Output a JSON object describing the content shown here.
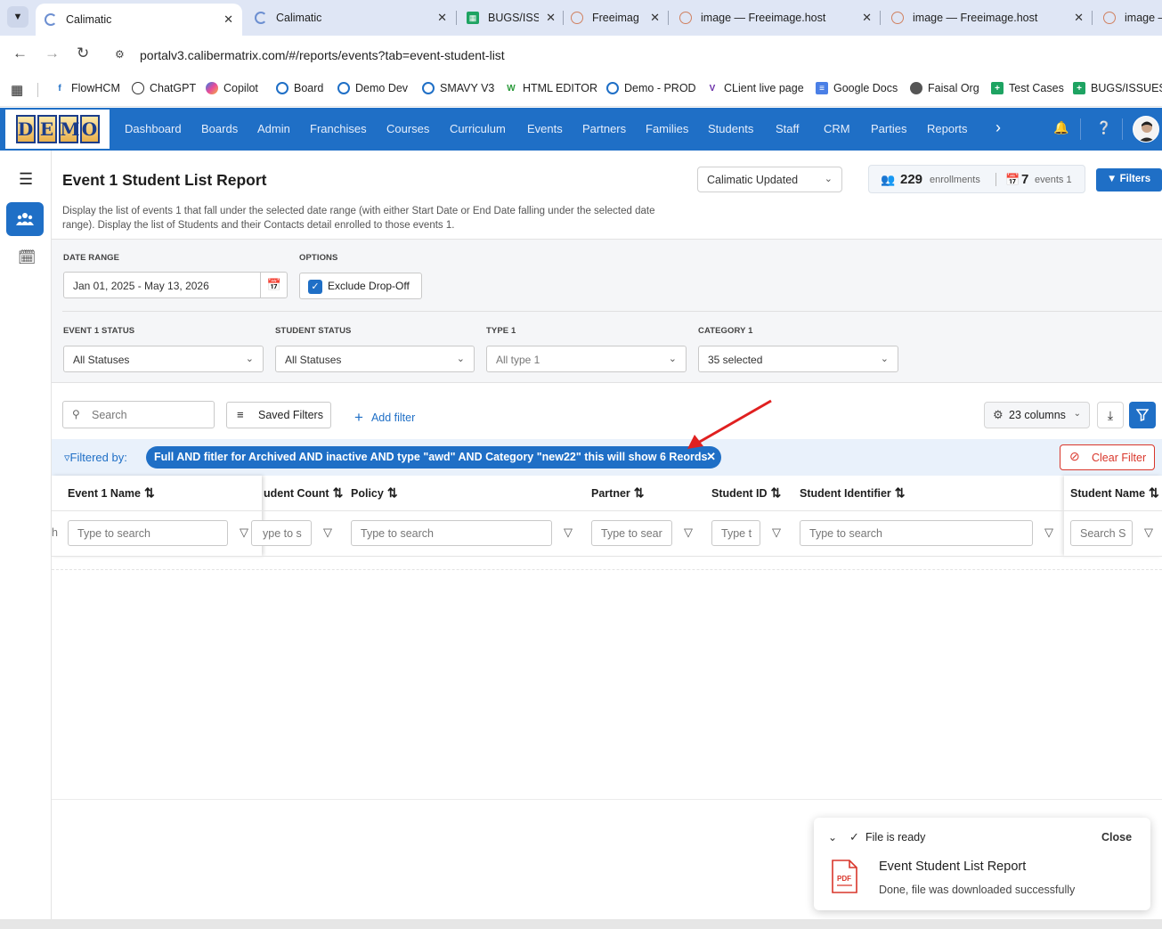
{
  "browser": {
    "tabs": [
      {
        "title": "Calimatic",
        "active": true
      },
      {
        "title": "Calimatic"
      },
      {
        "title": "BUGS/ISS"
      },
      {
        "title": "Freeimag"
      },
      {
        "title": "image — Freeimage.host"
      },
      {
        "title": "image — Freeimage.host"
      },
      {
        "title": "image –"
      }
    ],
    "url": "portalv3.calibermatrix.com/#/reports/events?tab=event-student-list",
    "bookmarks": [
      "FlowHCM",
      "ChatGPT",
      "Copilot",
      "Board",
      "Demo Dev",
      "SMAVY V3",
      "HTML EDITOR",
      "Demo - PROD",
      "CLient live page",
      "Google Docs",
      "Faisal Org",
      "Test Cases",
      "BUGS/ISSUES"
    ]
  },
  "app": {
    "logo_letters": [
      "D",
      "E",
      "M",
      "O"
    ],
    "nav": [
      "Dashboard",
      "Boards",
      "Admin",
      "Franchises",
      "Courses",
      "Curriculum",
      "Events",
      "Partners",
      "Families",
      "Students",
      "Staff",
      "CRM",
      "Parties",
      "Reports"
    ]
  },
  "header": {
    "title": "Event 1 Student List Report",
    "description": "Display the list of events 1 that fall under the selected date range (with either Start Date or End Date falling under the selected date range). Display the list of Students and their Contacts detail enrolled to those events 1.",
    "org_select": "Calimatic Updated",
    "enrollments_count": "229",
    "enrollments_label": "enrollments",
    "events_count": "7",
    "events_label": "events 1",
    "filters_label": "Filters"
  },
  "filters": {
    "date_range_label": "DATE RANGE",
    "date_range_value": "Jan 01, 2025 - May 13, 2026",
    "options_label": "OPTIONS",
    "exclude_dropoff_label": "Exclude Drop-Off",
    "exclude_dropoff_checked": true,
    "event_status_label": "EVENT 1 STATUS",
    "event_status_value": "All Statuses",
    "student_status_label": "STUDENT STATUS",
    "student_status_value": "All Statuses",
    "type_label": "TYPE 1",
    "type_value": "All type 1",
    "category_label": "CATEGORY 1",
    "category_value": "35 selected"
  },
  "toolbar": {
    "search_placeholder": "Search",
    "saved_filters": "Saved Filters",
    "add_filter": "Add filter",
    "columns": "23 columns"
  },
  "filtered_by": {
    "label": "Filtered by:",
    "chip": "Full AND fitler for Archived AND inactive AND type \"awd\" AND Category \"new22\" this will show 6 Reords",
    "clear": "Clear Filter"
  },
  "table": {
    "columns": [
      {
        "header": "Event 1 Name",
        "placeholder": "Type to search"
      },
      {
        "header": "udent Count",
        "placeholder": "ype to s"
      },
      {
        "header": "Policy",
        "placeholder": "Type to search"
      },
      {
        "header": "Partner",
        "placeholder": "Type to sear"
      },
      {
        "header": "Student ID",
        "placeholder": "Type t"
      },
      {
        "header": "Student Identifier",
        "placeholder": "Type to search"
      },
      {
        "header": "Student Name",
        "placeholder": "Search S"
      }
    ],
    "left_clip_text": "h"
  },
  "toast": {
    "status": "File is ready",
    "close": "Close",
    "file_icon_label": "PDF",
    "title": "Event Student List Report",
    "message": "Done, file was downloaded successfully"
  },
  "colors": {
    "brand": "#1f6fc6",
    "danger": "#d9362b",
    "arrow": "#e02020"
  }
}
